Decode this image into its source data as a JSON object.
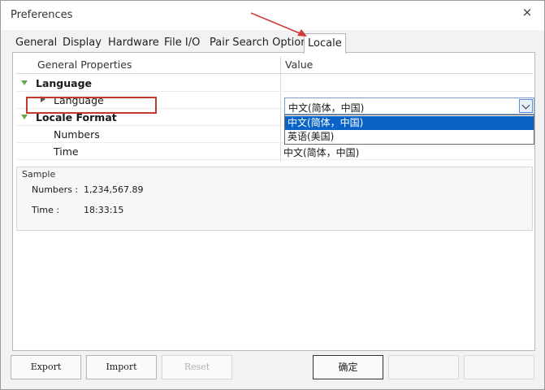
{
  "window": {
    "title": "Preferences",
    "close_glyph": "×"
  },
  "tabs": [
    {
      "label": "General"
    },
    {
      "label": "Display"
    },
    {
      "label": "Hardware"
    },
    {
      "label": "File I/O"
    },
    {
      "label": "Pair Search Option"
    },
    {
      "label": "Locale"
    }
  ],
  "active_tab": "Locale",
  "grid": {
    "header_property": "General Properties",
    "header_value": "Value",
    "groups": [
      {
        "label": "Language",
        "rows": [
          {
            "label": "Language",
            "value": "中文(简体，中国)"
          }
        ]
      },
      {
        "label": "Locale Format",
        "rows": [
          {
            "label": "Numbers",
            "value": ""
          },
          {
            "label": "Time",
            "value": "中文(简体，中国)"
          }
        ]
      }
    ]
  },
  "dropdown": {
    "current": "中文(简体，中国)",
    "options": [
      "中文(简体，中国)",
      "英语(美国)"
    ],
    "selected_index": 0
  },
  "sample": {
    "title": "Sample",
    "numbers_label": "Numbers :",
    "numbers_value": "1,234,567.89",
    "time_label": "Time :",
    "time_value": "18:33:15"
  },
  "buttons": {
    "export": "Export",
    "import": "Import",
    "reset": "Reset",
    "ok": "确定"
  },
  "colors": {
    "annotation_red": "#c0392b",
    "selection_blue": "#0b63c7"
  }
}
